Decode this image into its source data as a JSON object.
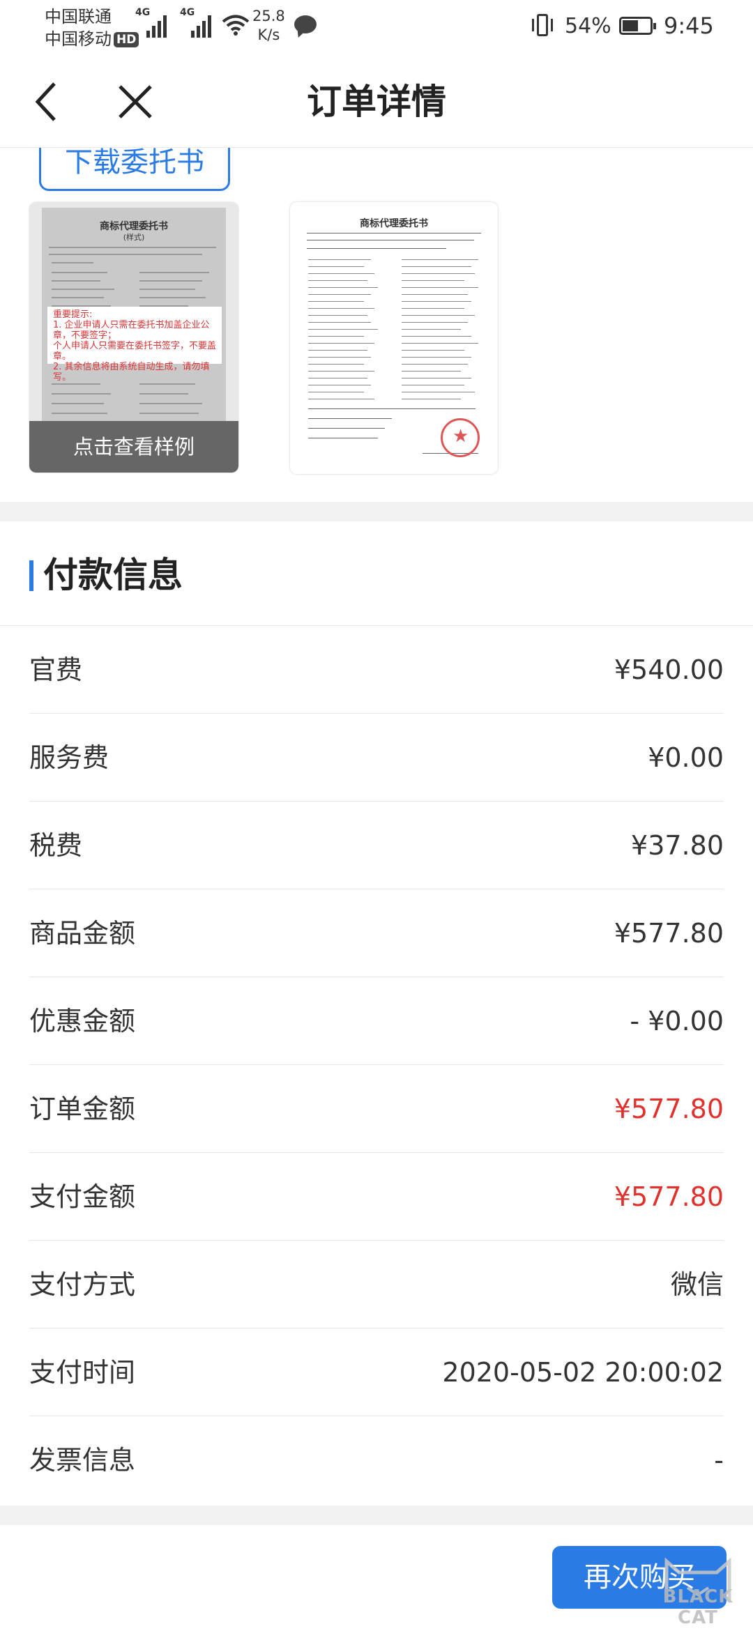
{
  "status_bar": {
    "carrier1": "中国联通",
    "carrier2": "中国移动",
    "hd": "HD",
    "net1": "4G",
    "net2": "4G",
    "speed_value": "25.8",
    "speed_unit": "K/s",
    "battery": "54%",
    "battery_level": 0.54,
    "time": "9:45"
  },
  "header": {
    "title": "订单详情"
  },
  "upload": {
    "download_label": "下载委托书",
    "sample_doc_title": "商标代理委托书",
    "sample_doc_subtitle": "(样式)",
    "notice_title": "重要提示:",
    "notice_line1": "1. 企业申请人只需在委托书加盖企业公章，不要签字；",
    "notice_line1b": "个人申请人只需要在委托书签字，不要盖章。",
    "notice_line2": "2. 其余信息将由系统自动生成，请勿填写。",
    "view_sample_label": "点击查看样例",
    "uploaded_doc_title": "商标代理委托书"
  },
  "payment": {
    "section_title": "付款信息",
    "rows": [
      {
        "label": "官费",
        "value": "¥540.00"
      },
      {
        "label": "服务费",
        "value": "¥0.00"
      },
      {
        "label": "税费",
        "value": "¥37.80"
      },
      {
        "label": "商品金额",
        "value": "¥577.80"
      },
      {
        "label": "优惠金额",
        "value": "- ¥0.00"
      },
      {
        "label": "订单金额",
        "value": "¥577.80"
      },
      {
        "label": "支付金额",
        "value": "¥577.80"
      },
      {
        "label": "支付方式",
        "value": "微信"
      },
      {
        "label": "支付时间",
        "value": "2020-05-02 20:00:02"
      },
      {
        "label": "发票信息",
        "value": "-"
      }
    ],
    "highlight_color": "#e0312c"
  },
  "bottom": {
    "rebuy_label": "再次购买"
  },
  "watermark": {
    "text": "BLACK CAT"
  },
  "colors": {
    "accent": "#2a7be4"
  }
}
